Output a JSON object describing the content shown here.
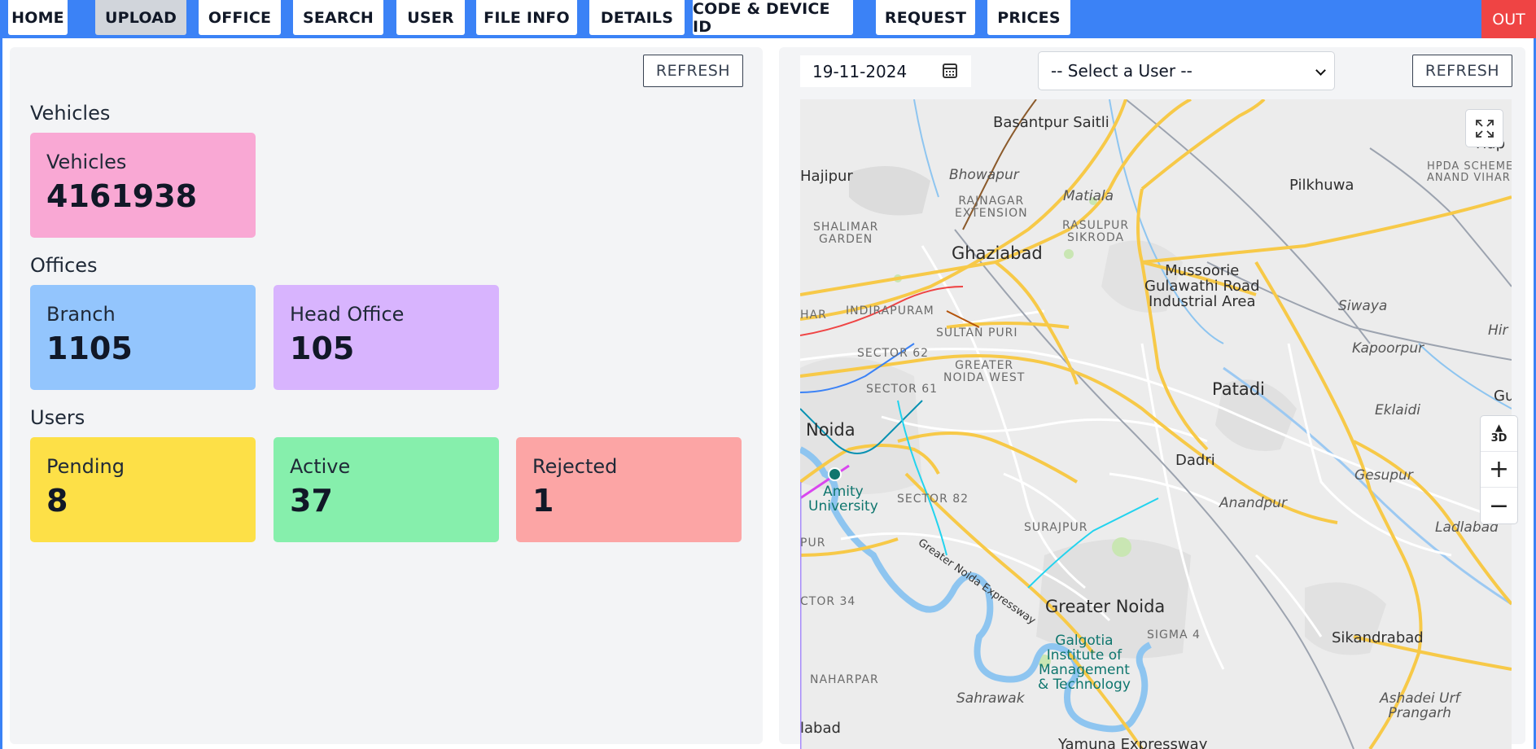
{
  "nav": {
    "items": [
      {
        "label": "HOME"
      },
      {
        "label": "UPLOAD"
      },
      {
        "label": "OFFICE"
      },
      {
        "label": "SEARCH"
      },
      {
        "label": "USER"
      },
      {
        "label": "FILE INFO"
      },
      {
        "label": "DETAILS"
      },
      {
        "label": "CODE & DEVICE ID"
      },
      {
        "label": "REQUEST"
      },
      {
        "label": "PRICES"
      }
    ],
    "active": "UPLOAD",
    "logout_label": "OUT"
  },
  "stats": {
    "refresh_label": "REFRESH",
    "vehicles": {
      "section": "Vehicles",
      "card_label": "Vehicles",
      "value": "4161938"
    },
    "offices": {
      "section": "Offices",
      "branch": {
        "label": "Branch",
        "value": "1105"
      },
      "head_office": {
        "label": "Head Office",
        "value": "105"
      }
    },
    "users": {
      "section": "Users",
      "pending": {
        "label": "Pending",
        "value": "8"
      },
      "active": {
        "label": "Active",
        "value": "37"
      },
      "rejected": {
        "label": "Rejected",
        "value": "1"
      }
    }
  },
  "tracking": {
    "date_value": "19-11-2024",
    "user_select_value": "-- Select a User --",
    "refresh_label": "REFRESH",
    "map_controls": {
      "threed_label": "3D",
      "zoom_in": "+",
      "zoom_out": "−"
    },
    "map_labels": {
      "basantpur": "Basantpur Saitli",
      "hajipur": "Hajipur",
      "bhowapur": "Bhowapur",
      "matiala": "Matiala",
      "pilkhuwa": "Pilkhuwa",
      "hapur": "Hap",
      "hpda": "HPDA SCHEME\nANAND VIHAR",
      "rajnagar": "RAJNAGAR\nEXTENSION",
      "shalimar": "SHALIMAR\nGARDEN",
      "rasulpur": "RASULPUR\nSIKRODA",
      "ghaziabad": "Ghaziabad",
      "mussoorie": "Mussoorie\nGulawathi Road\nIndustrial Area",
      "har": "HAR",
      "indirapuram": "INDIRAPURAM",
      "sultanpuri": "SULTAN PURI",
      "siwaya": "Siwaya",
      "hir": "Hir",
      "sector62": "SECTOR 62",
      "greater_noida_west": "GREATER\nNOIDA WEST",
      "kapoorpur": "Kapoorpur",
      "sector61": "SECTOR 61",
      "patadi": "Patadi",
      "gul": "Gul",
      "eklaidi": "Eklaidi",
      "noida": "Noida",
      "dadri": "Dadri",
      "gesupur": "Gesupur",
      "amity": "Amity\nUniversity",
      "sector82": "SECTOR 82",
      "anandpur": "Anandpur",
      "ladlabad": "Ladlabad",
      "surajpur": "SURAJPUR",
      "expressway": "Greater Noida Expressway",
      "pur": "PUR",
      "sector34": "CTOR 34",
      "greater_noida": "Greater Noida",
      "sigma4": "SIGMA 4",
      "galgotia": "Galgotia\nInstitute of\nManagement\n& Technology",
      "sikandrabad": "Sikandrabad",
      "naharpar": "NAHARPAR",
      "sahrawak": "Sahrawak",
      "ashadei": "Ashadei Urf\nPrangarh",
      "alabad": "labad",
      "yamuna": "Yamuna Expressway"
    }
  }
}
